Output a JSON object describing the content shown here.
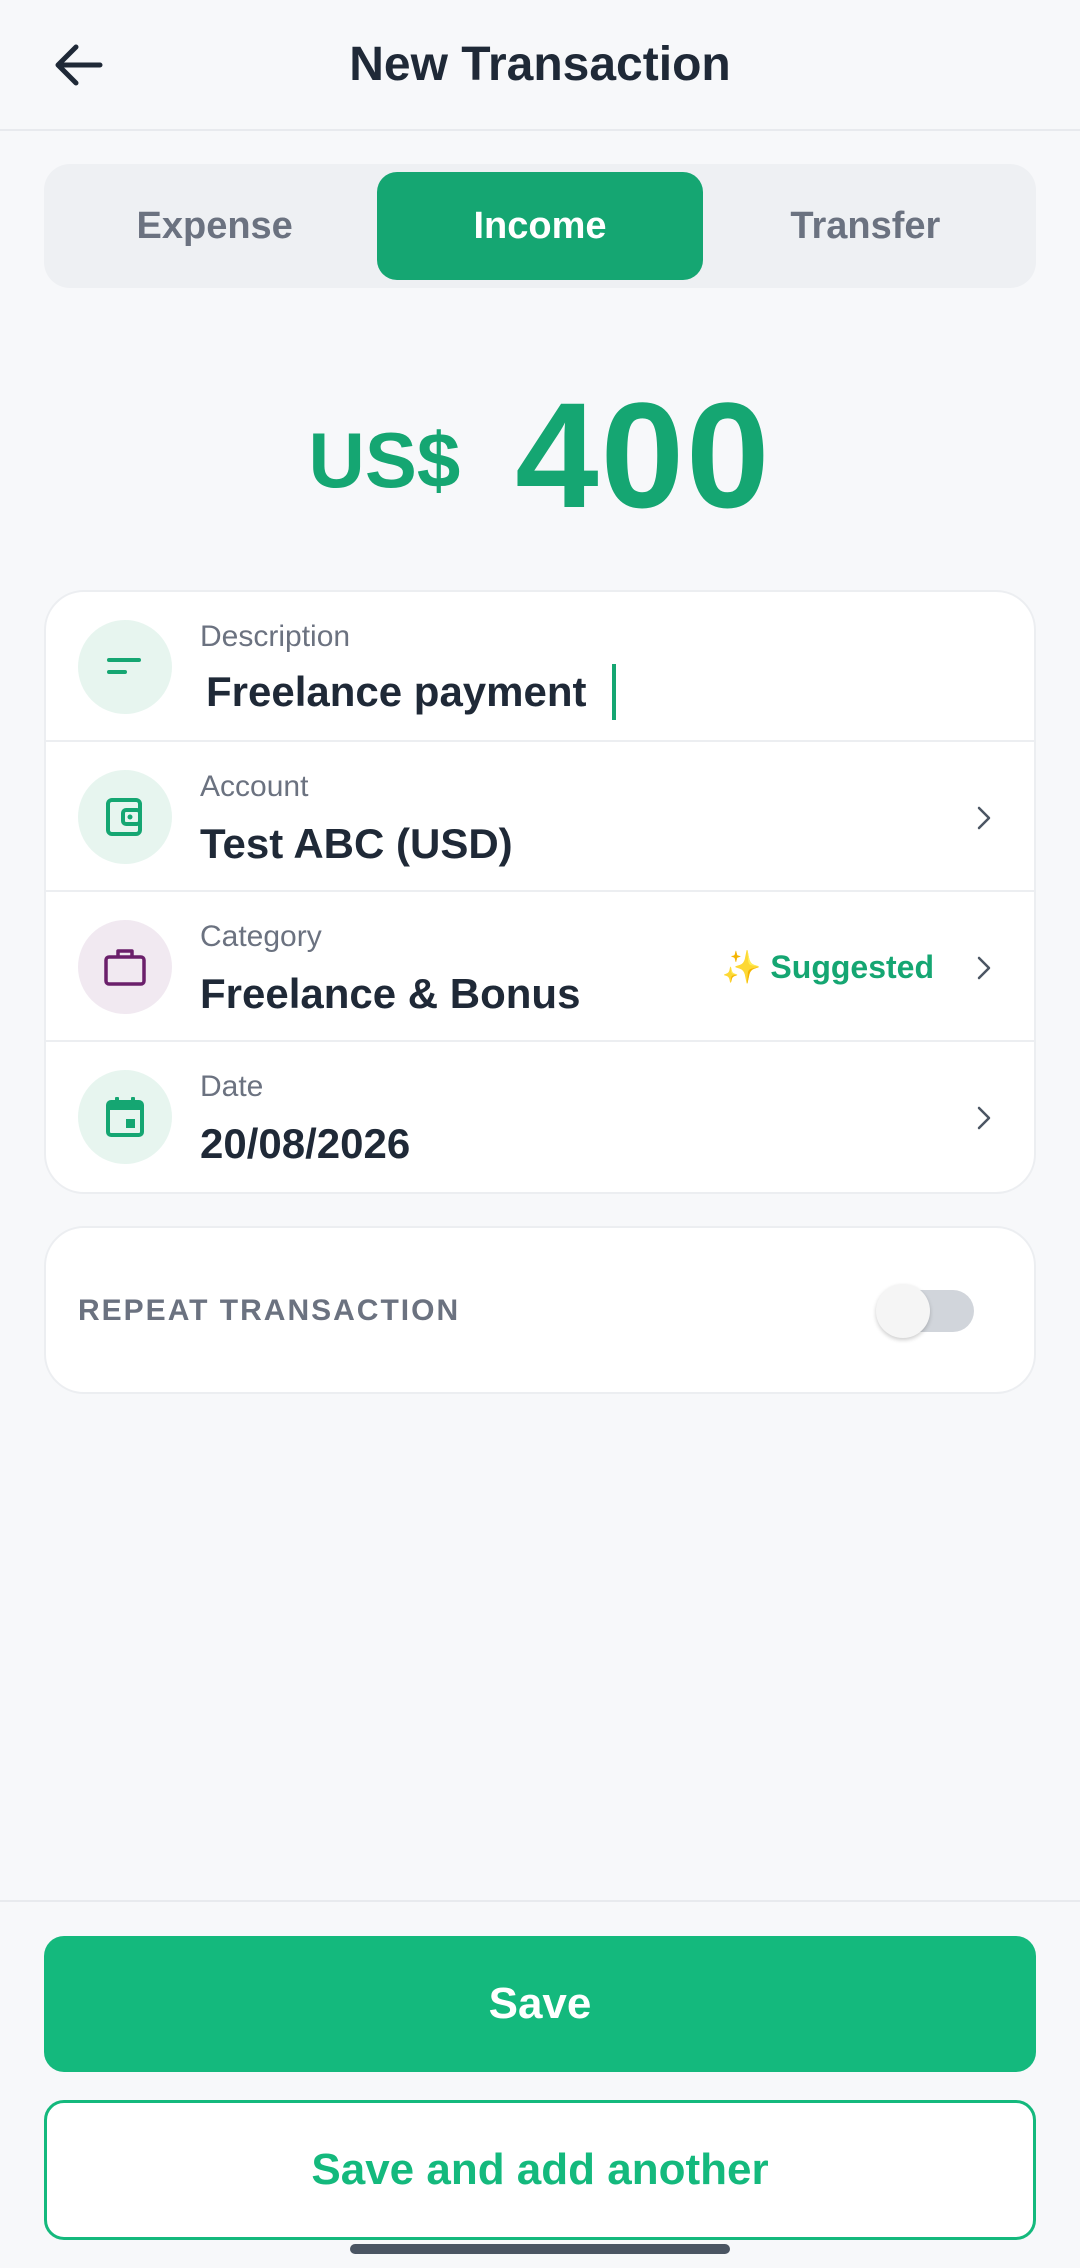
{
  "header": {
    "title": "New Transaction",
    "back_icon": "arrow-left-icon"
  },
  "tabs": [
    {
      "label": "Expense",
      "active": false
    },
    {
      "label": "Income",
      "active": true
    },
    {
      "label": "Transfer",
      "active": false
    }
  ],
  "amount": {
    "currency": "US$",
    "value": "400"
  },
  "fields": {
    "description": {
      "label": "Description",
      "value": "Freelance payment",
      "icon": "lines-icon"
    },
    "account": {
      "label": "Account",
      "value": "Test ABC (USD)",
      "icon": "wallet-icon"
    },
    "category": {
      "label": "Category",
      "value": "Freelance & Bonus",
      "badge": "✨ Suggested",
      "icon": "briefcase-icon"
    },
    "date": {
      "label": "Date",
      "value": "20/08/2026",
      "icon": "calendar-icon"
    }
  },
  "repeat": {
    "label": "REPEAT TRANSACTION",
    "enabled": false
  },
  "actions": {
    "save_label": "Save",
    "save_another_label": "Save and add another"
  },
  "colors": {
    "accent": "#15a672",
    "accent_button": "#14b97d",
    "category_icon": "#6b1f6b"
  }
}
